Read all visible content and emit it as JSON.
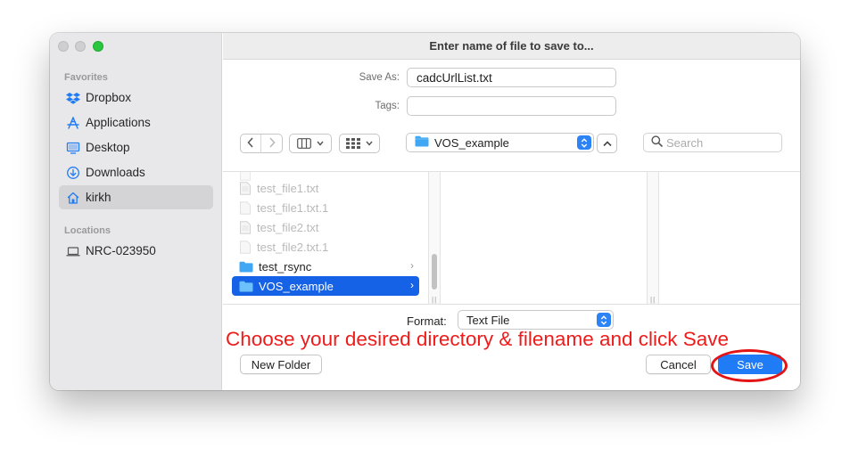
{
  "dialog": {
    "title": "Enter name of file to save to..."
  },
  "sidebar": {
    "favorites_heading": "Favorites",
    "favorites": [
      {
        "label": "Dropbox",
        "icon": "dropbox-icon"
      },
      {
        "label": "Applications",
        "icon": "applications-icon"
      },
      {
        "label": "Desktop",
        "icon": "desktop-icon"
      },
      {
        "label": "Downloads",
        "icon": "downloads-icon"
      },
      {
        "label": "kirkh",
        "icon": "home-icon",
        "selected": true
      }
    ],
    "locations_heading": "Locations",
    "locations": [
      {
        "label": "NRC-023950",
        "icon": "laptop-icon"
      }
    ]
  },
  "form": {
    "save_as_label": "Save As:",
    "save_as_value": "cadcUrlList.txt",
    "tags_label": "Tags:",
    "tags_value": ""
  },
  "toolbar": {
    "location": "VOS_example",
    "search_placeholder": "Search"
  },
  "files": [
    {
      "name": "test_file1.txt",
      "type": "file",
      "enabled": false
    },
    {
      "name": "test_file1.txt.1",
      "type": "file",
      "enabled": false
    },
    {
      "name": "test_file2.txt",
      "type": "file",
      "enabled": false
    },
    {
      "name": "test_file2.txt.1",
      "type": "file",
      "enabled": false
    },
    {
      "name": "test_rsync",
      "type": "folder",
      "enabled": true
    },
    {
      "name": "VOS_example",
      "type": "folder",
      "enabled": true,
      "selected": true
    }
  ],
  "format": {
    "label": "Format:",
    "value": "Text File"
  },
  "buttons": {
    "new_folder": "New Folder",
    "cancel": "Cancel",
    "save": "Save"
  },
  "annotation": {
    "text": "Choose your desired directory & filename and click Save",
    "color": "#ee1b1b"
  },
  "colors": {
    "accent": "#1f7cf6",
    "selection": "#1562e6",
    "folder": "#3fa7f3"
  }
}
